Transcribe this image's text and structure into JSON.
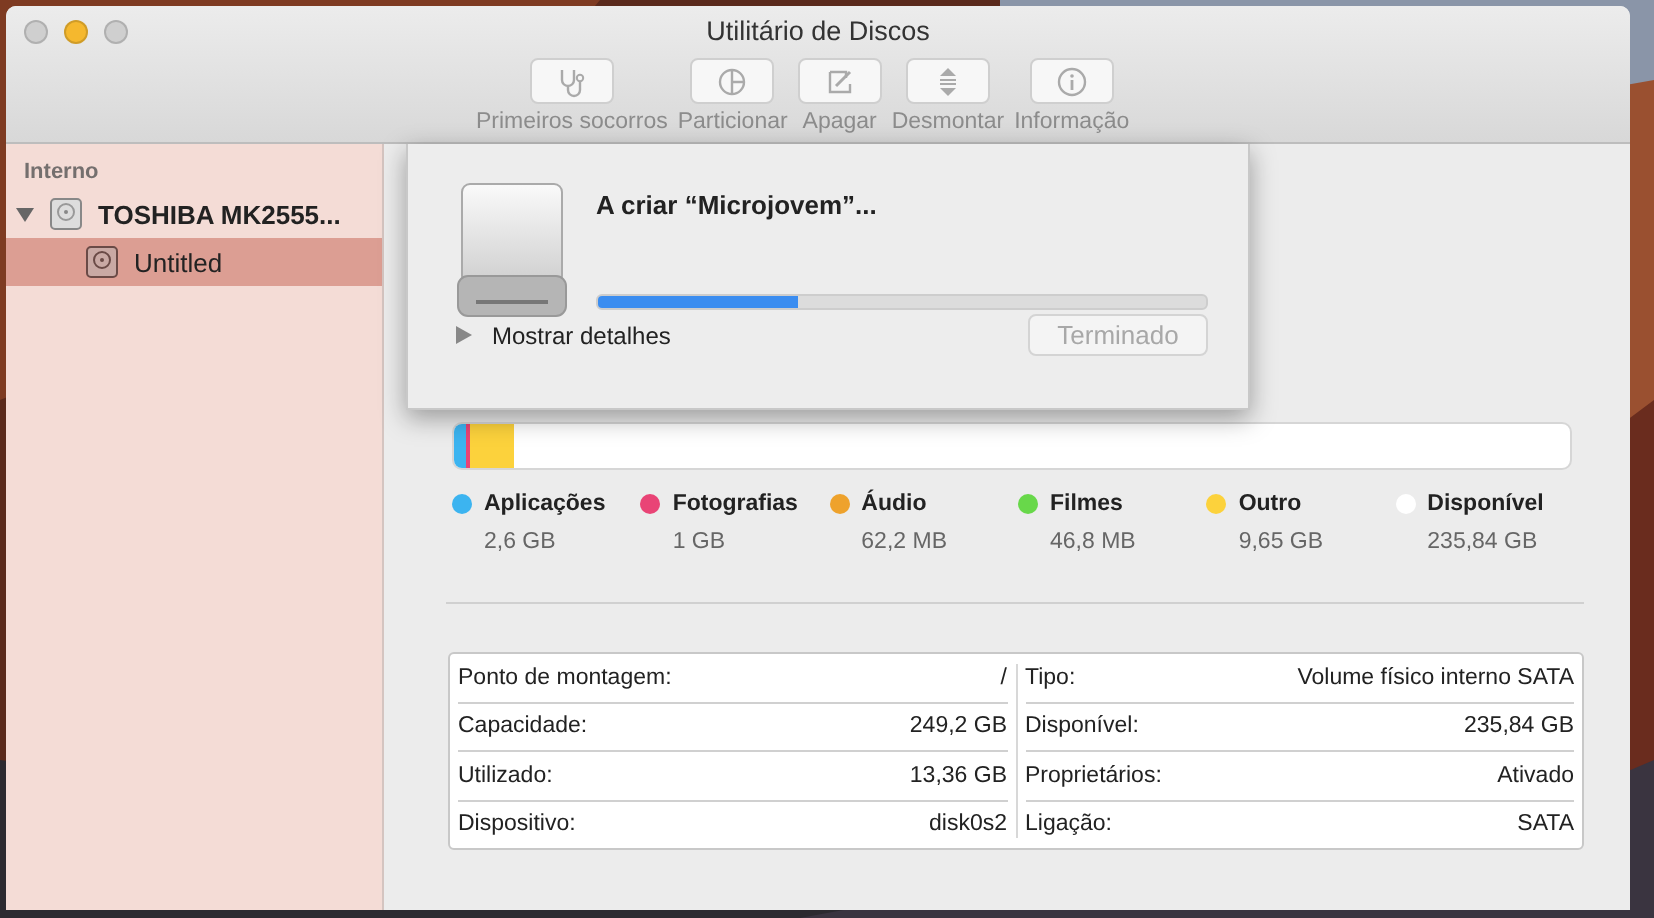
{
  "window": {
    "title": "Utilitário de Discos",
    "controls": [
      {
        "kind": "close",
        "active": false
      },
      {
        "kind": "minimize",
        "active": true
      },
      {
        "kind": "zoom",
        "active": false
      }
    ]
  },
  "toolbar": [
    {
      "kind": "first-aid",
      "label": "Primeiros socorros",
      "disabled": true
    },
    {
      "kind": "partition",
      "label": "Particionar",
      "disabled": true
    },
    {
      "kind": "erase",
      "label": "Apagar",
      "disabled": true
    },
    {
      "kind": "unmount",
      "label": "Desmontar",
      "disabled": true
    },
    {
      "kind": "info",
      "label": "Informação",
      "disabled": true
    }
  ],
  "sidebar": {
    "heading": "Interno",
    "items": [
      {
        "label": "TOSHIBA MK2555...",
        "expanded": true,
        "selected": false,
        "children": [
          {
            "label": "Untitled",
            "selected": true
          }
        ]
      }
    ]
  },
  "sheet": {
    "title": "A criar “Microjovem”...",
    "progress": {
      "level": 0.33
    },
    "details": {
      "label": "Mostrar detalhes",
      "expanded": false
    },
    "button": {
      "label": "Terminado",
      "disabled": true
    }
  },
  "usage_bar": [
    {
      "color": "#3cb4f0",
      "level": 0.0104
    },
    {
      "color": "#e94476",
      "level": 0.004
    },
    {
      "color": "#fcd23c",
      "level": 0.0387
    }
  ],
  "usage": [
    {
      "name": "Aplicações",
      "size": "2,6 GB",
      "color": "#3cb4f0"
    },
    {
      "name": "Fotografias",
      "size": "1 GB",
      "color": "#e94476"
    },
    {
      "name": "Áudio",
      "size": "62,2 MB",
      "color": "#eea22c"
    },
    {
      "name": "Filmes",
      "size": "46,8 MB",
      "color": "#68d84a"
    },
    {
      "name": "Outro",
      "size": "9,65 GB",
      "color": "#fcd23c"
    },
    {
      "name": "Disponível",
      "size": "235,84 GB",
      "color": "#ffffff"
    }
  ],
  "info": {
    "left": [
      {
        "label": "Ponto de montagem:",
        "value": "/"
      },
      {
        "label": "Capacidade:",
        "value": "249,2 GB"
      },
      {
        "label": "Utilizado:",
        "value": "13,36 GB"
      },
      {
        "label": "Dispositivo:",
        "value": "disk0s2"
      }
    ],
    "right": [
      {
        "label": "Tipo:",
        "value": "Volume físico interno SATA"
      },
      {
        "label": "Disponível:",
        "value": "235,84 GB"
      },
      {
        "label": "Proprietários:",
        "value": "Ativado"
      },
      {
        "label": "Ligação:",
        "value": "SATA"
      }
    ]
  }
}
